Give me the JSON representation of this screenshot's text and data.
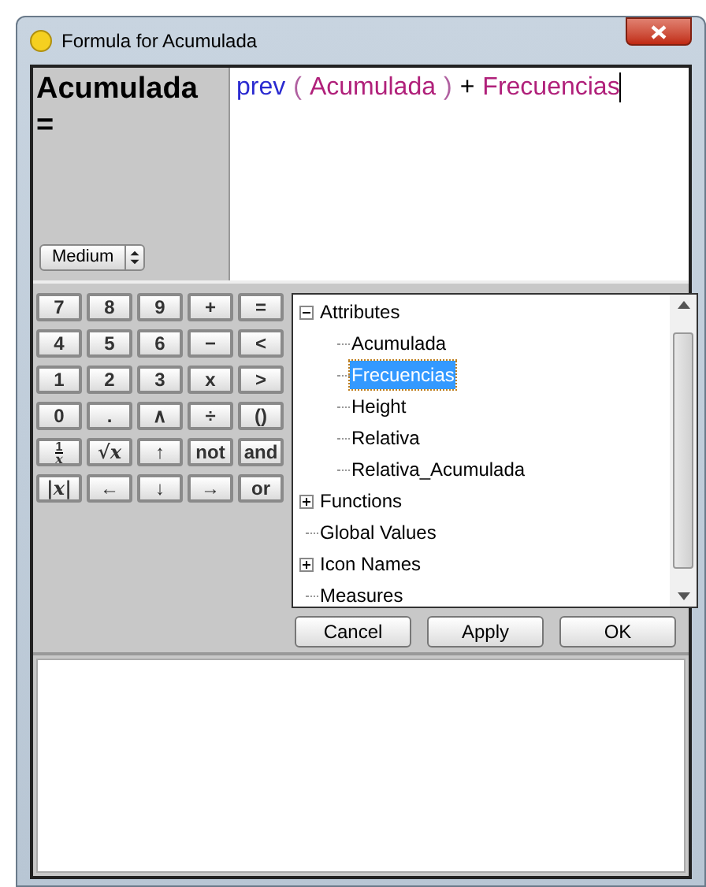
{
  "window": {
    "title": "Formula for Acumulada"
  },
  "attribute_label": {
    "name": "Acumulada",
    "sign": "="
  },
  "size_menu": {
    "value": "Medium"
  },
  "formula": [
    {
      "kind": "function",
      "text": "prev"
    },
    {
      "kind": "paren",
      "text": "("
    },
    {
      "kind": "attribute",
      "text": "Acumulada"
    },
    {
      "kind": "paren",
      "text": ")"
    },
    {
      "kind": "operator",
      "text": "+"
    },
    {
      "kind": "attribute",
      "text": "Frecuencias"
    }
  ],
  "keypad": [
    [
      {
        "kind": "text",
        "label": "7"
      },
      {
        "kind": "text",
        "label": "8"
      },
      {
        "kind": "text",
        "label": "9"
      },
      {
        "kind": "text",
        "label": "+"
      },
      {
        "kind": "text",
        "label": "="
      }
    ],
    [
      {
        "kind": "text",
        "label": "4"
      },
      {
        "kind": "text",
        "label": "5"
      },
      {
        "kind": "text",
        "label": "6"
      },
      {
        "kind": "text",
        "label": "−"
      },
      {
        "kind": "text",
        "label": "<"
      }
    ],
    [
      {
        "kind": "text",
        "label": "1"
      },
      {
        "kind": "text",
        "label": "2"
      },
      {
        "kind": "text",
        "label": "3"
      },
      {
        "kind": "text",
        "label": "x"
      },
      {
        "kind": "text",
        "label": ">"
      }
    ],
    [
      {
        "kind": "text",
        "label": "0"
      },
      {
        "kind": "text",
        "label": "."
      },
      {
        "kind": "text",
        "label": "∧"
      },
      {
        "kind": "text",
        "label": "÷"
      },
      {
        "kind": "text",
        "label": "()"
      }
    ],
    [
      {
        "kind": "fraction",
        "numerator": "1",
        "denominator": "x"
      },
      {
        "kind": "italic",
        "label": "√x"
      },
      {
        "kind": "text",
        "label": "↑"
      },
      {
        "kind": "text",
        "label": "not"
      },
      {
        "kind": "text",
        "label": "and"
      }
    ],
    [
      {
        "kind": "italic",
        "label": "|x|"
      },
      {
        "kind": "text",
        "label": "←"
      },
      {
        "kind": "text",
        "label": "↓"
      },
      {
        "kind": "text",
        "label": "→"
      },
      {
        "kind": "text",
        "label": "or"
      }
    ]
  ],
  "tree": [
    {
      "label": "Attributes",
      "expanded": true,
      "selected": false,
      "children": [
        {
          "label": "Acumulada",
          "selected": false
        },
        {
          "label": "Frecuencias",
          "selected": true
        },
        {
          "label": "Height",
          "selected": false
        },
        {
          "label": "Relativa",
          "selected": false
        },
        {
          "label": "Relativa_Acumulada",
          "selected": false
        }
      ]
    },
    {
      "label": "Functions",
      "expanded": false,
      "selected": false
    },
    {
      "label": "Global Values",
      "selected": false
    },
    {
      "label": "Icon Names",
      "expanded": false,
      "selected": false
    },
    {
      "label": "Measures",
      "selected": false
    }
  ],
  "buttons": [
    "Cancel",
    "Apply",
    "OK"
  ]
}
